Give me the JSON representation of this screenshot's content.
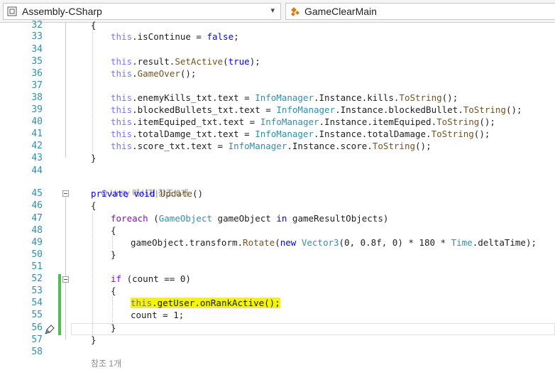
{
  "toolbar": {
    "project_combo": "Assembly-CSharp",
    "class_combo": "GameClearMain"
  },
  "line_numbers": [
    "32",
    "33",
    "34",
    "35",
    "36",
    "37",
    "38",
    "39",
    "40",
    "41",
    "42",
    "43",
    "44",
    "45",
    "46",
    "47",
    "48",
    "49",
    "50",
    "51",
    "52",
    "53",
    "54",
    "55",
    "56",
    "57",
    "58"
  ],
  "codelens": {
    "unity_ref": "Unity 메시지|참조 0개",
    "ref_one": "참조 1개"
  },
  "code": {
    "l32": "{",
    "l33": [
      "this",
      ".isContinue = ",
      "false",
      ";"
    ],
    "l35": [
      "this",
      ".result.",
      "SetActive",
      "(",
      "true",
      ");"
    ],
    "l36": [
      "this",
      ".",
      "GameOver",
      "();"
    ],
    "l38": [
      "this",
      ".enemyKills_txt.text = ",
      "InfoManager",
      ".Instance.kills.",
      "ToString",
      "();"
    ],
    "l39": [
      "this",
      ".blockedBullets_txt.text = ",
      "InfoManager",
      ".Instance.blockedBullet.",
      "ToString",
      "();"
    ],
    "l40": [
      "this",
      ".itemEquiped_txt.text = ",
      "InfoManager",
      ".Instance.itemEquiped.",
      "ToString",
      "();"
    ],
    "l41": [
      "this",
      ".totalDamge_txt.text = ",
      "InfoManager",
      ".Instance.totalDamage.",
      "ToString",
      "();"
    ],
    "l42": [
      "this",
      ".score_txt.text = ",
      "InfoManager",
      ".Instance.score.",
      "ToString",
      "();"
    ],
    "l43": "}",
    "l45": [
      "private",
      " ",
      "void",
      " ",
      "Update",
      "()"
    ],
    "l46": "{",
    "l47": [
      "foreach",
      " (",
      "GameObject",
      " gameObject ",
      "in",
      " gameResultObjects)"
    ],
    "l48": "{",
    "l49": [
      "gameObject.transform.",
      "Rotate",
      "(",
      "new",
      " ",
      "Vector3",
      "(0, 0.8f, 0) * 180 * ",
      "Time",
      ".deltaTime);"
    ],
    "l50": "}",
    "l52": [
      "if",
      " (count == 0)"
    ],
    "l53": "{",
    "l54": [
      "this",
      ".getUser.onRankActive();"
    ],
    "l55": "count = 1;",
    "l56": "}",
    "l57": "}"
  },
  "colors": {
    "keyword": "#0000ff",
    "type": "#2b91af",
    "method": "#74531f",
    "linenumber": "#2b91af",
    "highlight": "#f5f500",
    "changebar": "#4fbf4f"
  }
}
